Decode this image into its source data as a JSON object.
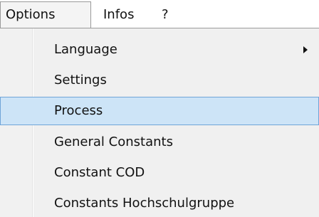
{
  "menubar": {
    "options_label": "Options",
    "infos_label": "Infos",
    "help_label": "?"
  },
  "options_menu": {
    "items": [
      {
        "label": "Language",
        "has_submenu": true
      },
      {
        "label": "Settings"
      },
      {
        "label": "Process",
        "highlighted": true
      },
      {
        "label": "General Constants"
      },
      {
        "label": "Constant COD"
      },
      {
        "label": "Constants Hochschulgruppe"
      }
    ]
  },
  "colors": {
    "highlight_fill": "#cde4f7",
    "highlight_border": "#6fa5d8",
    "menu_background": "#f0f0f0"
  },
  "icons": {
    "submenu": "chevron-right-icon"
  }
}
